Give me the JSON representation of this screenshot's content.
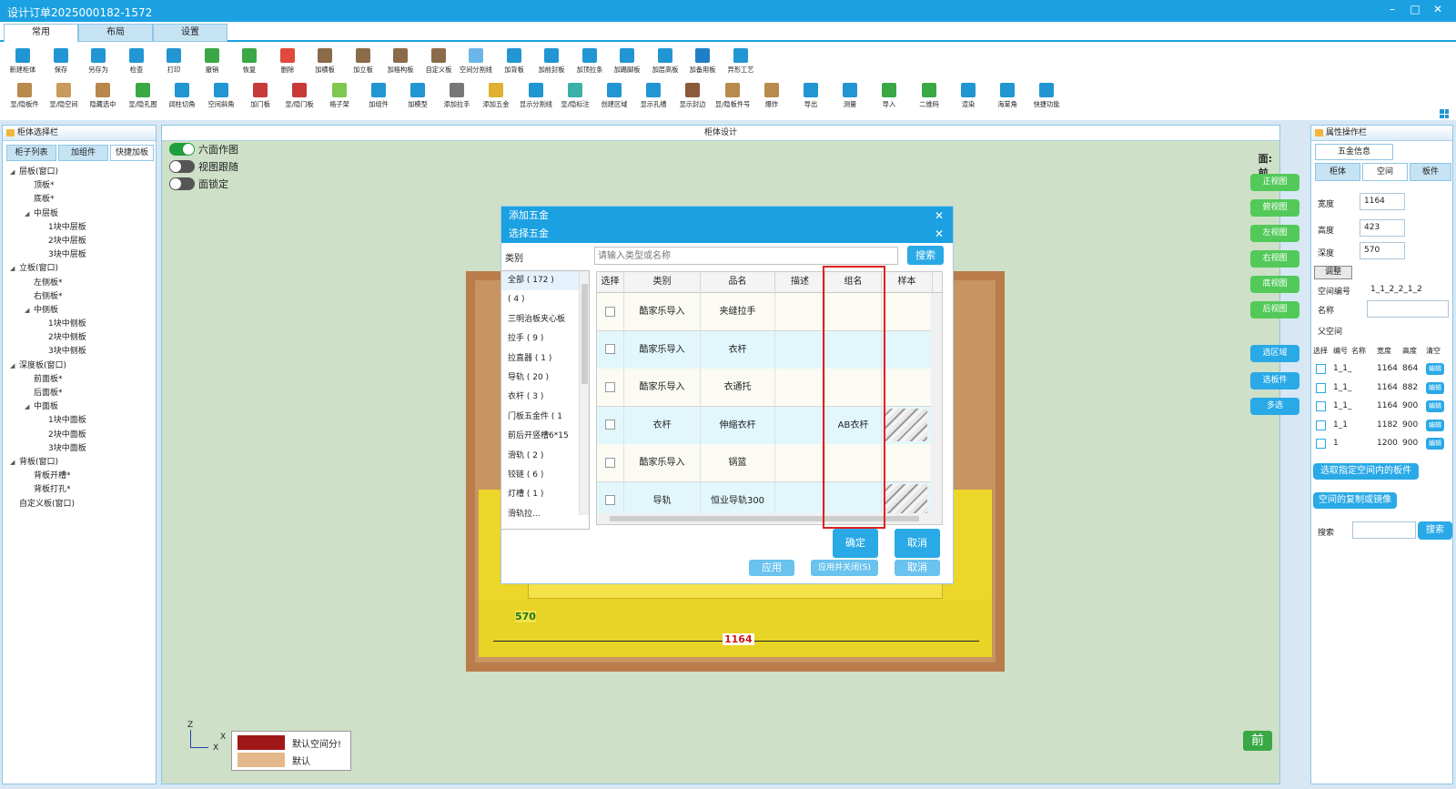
{
  "window": {
    "title": "设计订单2025000182-1572",
    "min": "–",
    "max": "□",
    "close": "✕"
  },
  "ribbon_tabs": [
    "常用",
    "布局",
    "设置"
  ],
  "toolbar_row1": [
    {
      "label": "新建柜体",
      "color": "#2196d3"
    },
    {
      "label": "保存",
      "color": "#2196d3"
    },
    {
      "label": "另存为",
      "color": "#2196d3"
    },
    {
      "label": "检查",
      "color": "#2196d3"
    },
    {
      "label": "打印",
      "color": "#2196d3"
    },
    {
      "label": "撤销",
      "color": "#3aa845"
    },
    {
      "label": "恢复",
      "color": "#3aa845"
    },
    {
      "label": "删除",
      "color": "#e04a3a"
    },
    {
      "label": "加横板",
      "color": "#8b6b4a"
    },
    {
      "label": "加立板",
      "color": "#8b6b4a"
    },
    {
      "label": "加格构板",
      "color": "#8b6b4a"
    },
    {
      "label": "自定义板",
      "color": "#8b6b4a"
    },
    {
      "label": "空间分割线",
      "color": "#6ab6e8"
    },
    {
      "label": "加背板",
      "color": "#2196d3"
    },
    {
      "label": "加前封板",
      "color": "#2196d3"
    },
    {
      "label": "加顶拉条",
      "color": "#2196d3"
    },
    {
      "label": "加踢脚板",
      "color": "#2196d3"
    },
    {
      "label": "加层高板",
      "color": "#2196d3"
    },
    {
      "label": "加备用板",
      "color": "#1f7fc6"
    },
    {
      "label": "异形工艺",
      "color": "#2196d3"
    }
  ],
  "toolbar_row2": [
    {
      "label": "显/隐板件",
      "color": "#b88a4c"
    },
    {
      "label": "显/隐空间",
      "color": "#c99a5c"
    },
    {
      "label": "隐藏选中",
      "color": "#b8874a"
    },
    {
      "label": "显/隐孔图",
      "color": "#3aa845"
    },
    {
      "label": "阔柱切角",
      "color": "#2196d3"
    },
    {
      "label": "空间斜角",
      "color": "#2196d3"
    },
    {
      "label": "加门板",
      "color": "#c83a3a"
    },
    {
      "label": "显/隐门板",
      "color": "#c83a3a"
    },
    {
      "label": "格子架",
      "color": "#7ec850"
    },
    {
      "label": "加组件",
      "color": "#2196d3"
    },
    {
      "label": "加模型",
      "color": "#2196d3"
    },
    {
      "label": "添加拉手",
      "color": "#777777"
    },
    {
      "label": "添加五金",
      "color": "#e0b030"
    },
    {
      "label": "显示分割线",
      "color": "#2196d3"
    },
    {
      "label": "显/隐标注",
      "color": "#3ab0a8"
    },
    {
      "label": "创建区域",
      "color": "#2196d3"
    },
    {
      "label": "显示孔槽",
      "color": "#2196d3"
    },
    {
      "label": "显示封边",
      "color": "#8b5a3a"
    },
    {
      "label": "显/隐板件号",
      "color": "#b88a4c"
    },
    {
      "label": "爆炸",
      "color": "#b88a4c"
    },
    {
      "label": "导出",
      "color": "#2196d3"
    },
    {
      "label": "测量",
      "color": "#2196d3"
    },
    {
      "label": "导入",
      "color": "#3aa845"
    },
    {
      "label": "二维码",
      "color": "#3aa845"
    },
    {
      "label": "渲染",
      "color": "#2196d3"
    },
    {
      "label": "海棠角",
      "color": "#2196d3"
    },
    {
      "label": "快捷功能",
      "color": "#2196d3"
    }
  ],
  "left_panel": {
    "title": "柜体选择栏",
    "tabs": [
      "柜子列表",
      "加组件",
      "快捷加板"
    ],
    "tree": [
      {
        "label": "层板(窗口)",
        "level": 0,
        "arrow": "◢"
      },
      {
        "label": "顶板*",
        "level": 1,
        "arrow": ""
      },
      {
        "label": "底板*",
        "level": 1,
        "arrow": ""
      },
      {
        "label": "中层板",
        "level": 1,
        "arrow": "◢"
      },
      {
        "label": "1块中层板",
        "level": 2,
        "arrow": ""
      },
      {
        "label": "2块中层板",
        "level": 2,
        "arrow": ""
      },
      {
        "label": "3块中层板",
        "level": 2,
        "arrow": ""
      },
      {
        "label": "立板(窗口)",
        "level": 0,
        "arrow": "◢"
      },
      {
        "label": "左侧板*",
        "level": 1,
        "arrow": ""
      },
      {
        "label": "右侧板*",
        "level": 1,
        "arrow": ""
      },
      {
        "label": "中侧板",
        "level": 1,
        "arrow": "◢"
      },
      {
        "label": "1块中侧板",
        "level": 2,
        "arrow": ""
      },
      {
        "label": "2块中侧板",
        "level": 2,
        "arrow": ""
      },
      {
        "label": "3块中侧板",
        "level": 2,
        "arrow": ""
      },
      {
        "label": "深度板(窗口)",
        "level": 0,
        "arrow": "◢"
      },
      {
        "label": "前面板*",
        "level": 1,
        "arrow": ""
      },
      {
        "label": "后面板*",
        "level": 1,
        "arrow": ""
      },
      {
        "label": "中面板",
        "level": 1,
        "arrow": "◢"
      },
      {
        "label": "1块中面板",
        "level": 2,
        "arrow": ""
      },
      {
        "label": "2块中面板",
        "level": 2,
        "arrow": ""
      },
      {
        "label": "3块中面板",
        "level": 2,
        "arrow": ""
      },
      {
        "label": "背板(窗口)",
        "level": 0,
        "arrow": "◢"
      },
      {
        "label": "背板开槽*",
        "level": 1,
        "arrow": ""
      },
      {
        "label": "背板打孔*",
        "level": 1,
        "arrow": ""
      },
      {
        "label": "自定义板(窗口)",
        "level": 0,
        "arrow": ""
      }
    ]
  },
  "viewport": {
    "title": "柜体设计",
    "toggles": [
      {
        "label": "六面作图",
        "on": true
      },
      {
        "label": "视图跟随",
        "on": false
      },
      {
        "label": "面锁定",
        "on": false
      }
    ],
    "face_label": "面:前",
    "view_buttons": [
      "正视图",
      "俯视图",
      "左视图",
      "右视图",
      "底视图",
      "后视图"
    ],
    "select_buttons": [
      "选区域",
      "选板件",
      "多选"
    ],
    "dim_depth": "570",
    "dim_width": "1164",
    "axis_z": "Z",
    "axis_x": "X",
    "axis_x2": "X",
    "legend": [
      {
        "label": "默认空间分!",
        "color": "#a01818"
      },
      {
        "label": "默认",
        "color": "#e4b88a"
      }
    ],
    "front_badge": "前"
  },
  "dialog_back": {
    "title": "添加五金",
    "close": "✕",
    "hidden_buttons": [
      "应用",
      "应用并关闭(S)",
      "取消"
    ]
  },
  "dialog": {
    "title": "选择五金",
    "close": "✕",
    "category_label": "类别",
    "search_placeholder": "请输入类型或名称",
    "search_button": "搜索",
    "categories": [
      "全部 ( 172 )",
      " ( 4 )",
      "三明治板夹心板",
      "拉手 ( 9 )",
      "拉直器 ( 1 )",
      "导轨 ( 20 )",
      "衣杆 ( 3 )",
      "门板五金件 ( 1",
      "前后开竖槽6*15",
      "滑轨 ( 2 )",
      "铰链 ( 6 )",
      "灯槽 ( 1 )",
      "滑轨拉..."
    ],
    "columns": [
      "选择",
      "类别",
      "品名",
      "描述",
      "组名",
      "样本"
    ],
    "rows": [
      {
        "category": "酷家乐导入",
        "name": "夹缝拉手",
        "desc": "",
        "group": "",
        "sample": false
      },
      {
        "category": "酷家乐导入",
        "name": "衣杆",
        "desc": "",
        "group": "",
        "sample": false
      },
      {
        "category": "酷家乐导入",
        "name": "衣通托",
        "desc": "",
        "group": "",
        "sample": false
      },
      {
        "category": "衣杆",
        "name": "伸缩衣杆",
        "desc": "",
        "group": "AB衣杆",
        "sample": true
      },
      {
        "category": "酷家乐导入",
        "name": "锅篮",
        "desc": "",
        "group": "",
        "sample": false
      },
      {
        "category": "导轨",
        "name": "恒业导轨300",
        "desc": "",
        "group": "",
        "sample": true
      }
    ],
    "ok": "确定",
    "cancel": "取消"
  },
  "right_panel": {
    "title": "属性操作栏",
    "top_tab": "五金信息",
    "tabs": [
      "柜体",
      "空间",
      "板件"
    ],
    "width_label": "宽度",
    "width": "1164",
    "height_label": "高度",
    "height": "423",
    "depth_label": "深度",
    "depth": "570",
    "adjust_btn": "调整",
    "space_no_label": "空间编号",
    "space_no": "1_1_2_2_1_2",
    "name_label": "名称",
    "name": "",
    "parent_label": "父空间",
    "table_headers": [
      "选择",
      "编号",
      "名称",
      "宽度",
      "高度",
      "清空"
    ],
    "table_rows": [
      {
        "id": "1_1_",
        "w": "1164",
        "h": "864",
        "btn": "编辑"
      },
      {
        "id": "1_1_",
        "w": "1164",
        "h": "882",
        "btn": "编辑"
      },
      {
        "id": "1_1_",
        "w": "1164",
        "h": "900",
        "btn": "编辑"
      },
      {
        "id": "1_1",
        "w": "1182",
        "h": "900",
        "btn": "编辑"
      },
      {
        "id": "1",
        "w": "1200",
        "h": "900",
        "btn": "编辑"
      }
    ],
    "select_boards_btn": "选取指定空间内的板件",
    "copy_mirror_btn": "空间的复制或镜像",
    "search_label": "搜索",
    "search_value": "",
    "search_btn": "搜索"
  }
}
